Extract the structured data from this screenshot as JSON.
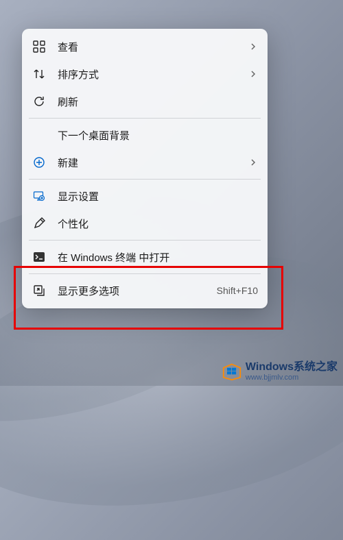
{
  "menu": {
    "items": [
      {
        "icon": "view-icon",
        "label": "查看",
        "submenu": true
      },
      {
        "icon": "sort-icon",
        "label": "排序方式",
        "submenu": true
      },
      {
        "icon": "refresh-icon",
        "label": "刷新"
      }
    ],
    "group2": [
      {
        "icon": "none",
        "label": "下一个桌面背景"
      },
      {
        "icon": "new-icon",
        "label": "新建",
        "submenu": true
      }
    ],
    "group3": [
      {
        "icon": "display-icon",
        "label": "显示设置"
      },
      {
        "icon": "personalize-icon",
        "label": "个性化"
      }
    ],
    "group4": [
      {
        "icon": "terminal-icon",
        "label": "在 Windows 终端 中打开"
      }
    ],
    "group5": [
      {
        "icon": "more-icon",
        "label": "显示更多选项",
        "shortcut": "Shift+F10"
      }
    ]
  },
  "watermark": {
    "title": "Windows系统之家",
    "url": "www.bjjmlv.com"
  }
}
